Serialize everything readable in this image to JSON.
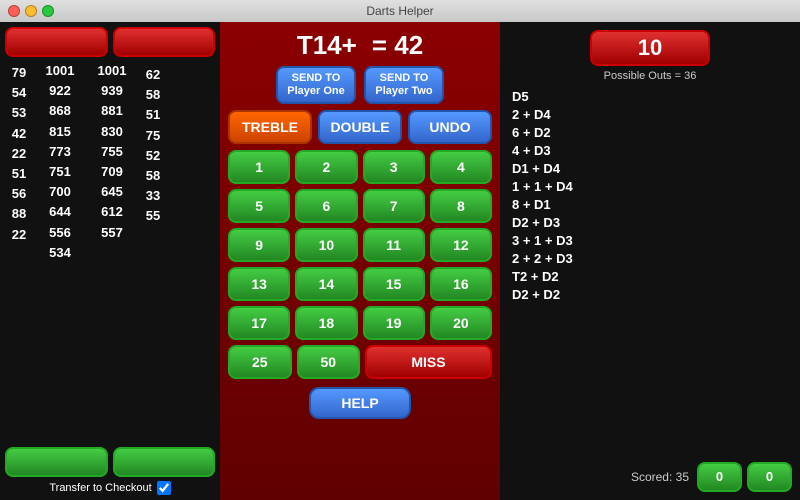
{
  "titlebar": {
    "title": "Darts Helper"
  },
  "left": {
    "btn1_label": "",
    "btn2_label": "",
    "scores": [
      {
        "left": "79",
        "col1": "1001",
        "col2": "1001",
        "right": ""
      },
      {
        "left": "54",
        "col1": "922",
        "col2": "939",
        "right": "62"
      },
      {
        "left": "53",
        "col1": "868",
        "col2": "881",
        "right": "58"
      },
      {
        "left": "42",
        "col1": "815",
        "col2": "830",
        "right": "51"
      },
      {
        "left": "22",
        "col1": "773",
        "col2": "755",
        "right": "75"
      },
      {
        "left": "51",
        "col1": "751",
        "col2": "709",
        "right": "52"
      },
      {
        "left": "56",
        "col1": "700",
        "col2": "645",
        "right": "58"
      },
      {
        "left": "88",
        "col1": "644",
        "col2": "612",
        "right": "33"
      },
      {
        "left": "22",
        "col1": "556",
        "col2": "557",
        "right": "55"
      },
      {
        "left": "",
        "col1": "534",
        "col2": "",
        "right": ""
      }
    ],
    "bottom_btn1": "",
    "bottom_btn2": "",
    "transfer_label": "Transfer to Checkout"
  },
  "center": {
    "dart_code": "T14+",
    "equals_value": "= 42",
    "send_player_one": "SEND TO\nPlayer One",
    "send_player_two": "SEND TO\nPlayer Two",
    "treble_label": "TREBLE",
    "double_label": "DOUBLE",
    "undo_label": "UNDO",
    "numbers": [
      "1",
      "2",
      "3",
      "4",
      "5",
      "6",
      "7",
      "8",
      "9",
      "10",
      "11",
      "12",
      "13",
      "14",
      "15",
      "16",
      "17",
      "18",
      "19",
      "20"
    ],
    "btn_25": "25",
    "btn_50": "50",
    "btn_miss": "MISS",
    "help_label": "HELP"
  },
  "right": {
    "score": "10",
    "possible_outs": "Possible Outs = 36",
    "checkouts": [
      "D5",
      "2 + D4",
      "6 + D2",
      "4 + D3",
      "D1 + D4",
      "1 + 1 + D4",
      "8 + D1",
      "D2 + D3",
      "3 + 1 + D3",
      "2 + 2 + D3",
      "T2 + D2",
      "D2 + D2"
    ],
    "scored_label": "Scored: 35",
    "scored_val1": "0",
    "scored_val2": "0"
  }
}
